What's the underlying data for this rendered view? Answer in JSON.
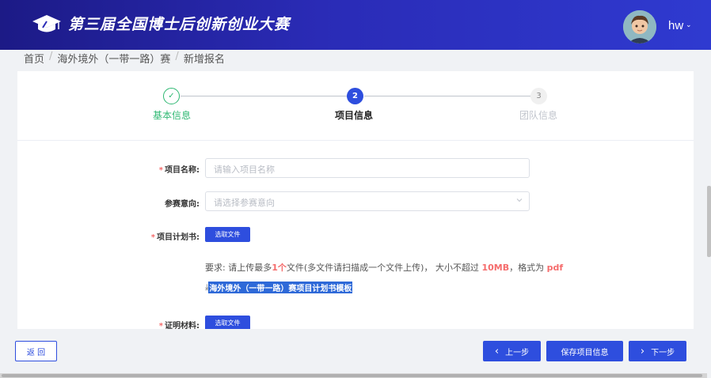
{
  "header": {
    "title": "第三届全国博士后创新创业大赛",
    "user_name": "hw",
    "user_caret": "⌄",
    "logo_icon": "graduation-cap-icon",
    "gradient_start": "#1c1a86",
    "gradient_end": "#2f3ad0"
  },
  "breadcrumb": {
    "items": [
      "首页",
      "海外境外（一带一路）赛",
      "新增报名"
    ],
    "separator": "/"
  },
  "steps": [
    {
      "number": "✓",
      "label": "基本信息",
      "status": "finished",
      "color": "#2eb872"
    },
    {
      "number": "2",
      "label": "项目信息",
      "status": "active",
      "color": "#2e4ede"
    },
    {
      "number": "3",
      "label": "团队信息",
      "status": "wait",
      "color": "#c0c4cc"
    }
  ],
  "form": {
    "project_name": {
      "required_mark": "*",
      "label": "项目名称:",
      "placeholder": "请输入项目名称",
      "value": ""
    },
    "intent": {
      "label": "参赛意向:",
      "placeholder": "请选择参赛意向",
      "value": ""
    },
    "plan": {
      "required_mark": "*",
      "label": "项目计划书:",
      "button": "选取文件"
    },
    "note": {
      "prefix": "要求: 请上传最多",
      "count": "1个",
      "middle": "文件(多文件请扫描成一个文件上传)，  大小不超过 ",
      "size": "10MB",
      "sep": "，格式为 ",
      "format": "pdf"
    },
    "template": {
      "icon": "download-icon",
      "glyph": "⤓",
      "link": "海外境外（一带一路）赛项目计划书模板"
    },
    "proof": {
      "required_mark": "*",
      "label": "证明材料:",
      "button": "选取文件"
    }
  },
  "footer": {
    "back": "返 回",
    "prev": "上一步",
    "save": "保存项目信息",
    "next": "下一步",
    "prev_glyph": "‹",
    "next_glyph": "›"
  },
  "colors": {
    "accent": "#2e4ede",
    "success": "#2eb872",
    "required": "#f56c6c"
  }
}
